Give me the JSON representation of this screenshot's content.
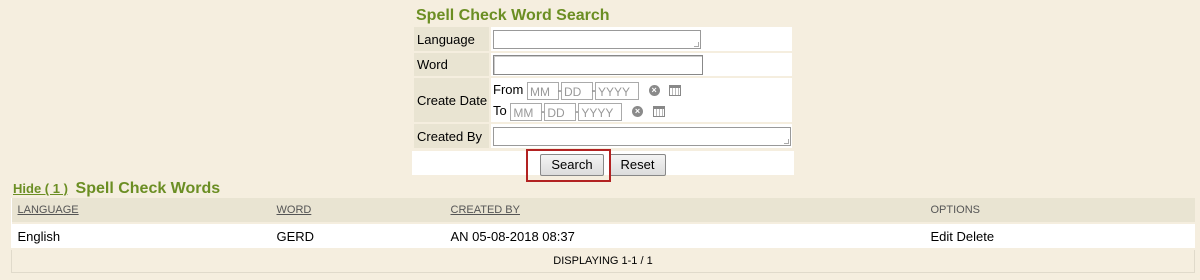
{
  "search_form": {
    "title": "Spell Check Word Search",
    "language": {
      "label": "Language",
      "value": ""
    },
    "word": {
      "label": "Word",
      "value": ""
    },
    "create_date": {
      "label": "Create Date",
      "from_label": "From",
      "to_label": "To",
      "month_placeholder": "MM",
      "day_placeholder": "DD",
      "year_placeholder": "YYYY",
      "separator": "-"
    },
    "created_by": {
      "label": "Created By",
      "value": ""
    },
    "search_button": "Search",
    "reset_button": "Reset",
    "highlight_color": "#b22222"
  },
  "results": {
    "hide_link": "Hide ( 1 )",
    "title": "Spell Check Words",
    "columns": [
      "LANGUAGE",
      "WORD",
      "CREATED BY",
      "OPTIONS"
    ],
    "rows": [
      {
        "language": "English",
        "word": "GERD",
        "created_by": "AN 05-08-2018 08:37",
        "edit": "Edit",
        "delete": "Delete"
      }
    ],
    "footer": "DISPLAYING 1-1 / 1"
  },
  "colors": {
    "background": "#f5eedf",
    "accent_green": "#6b8e23",
    "label_cell": "#e9e4d2"
  }
}
